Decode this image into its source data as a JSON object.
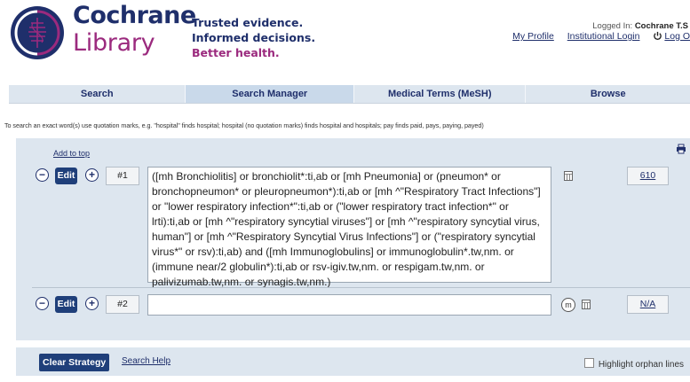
{
  "brand": {
    "line1": "Cochrane",
    "line2": "Library"
  },
  "tagline": {
    "line1": "Trusted evidence.",
    "line2": "Informed decisions.",
    "line3": "Better health."
  },
  "account": {
    "logged_in_label": "Logged In:",
    "logged_in_name": "Cochrane T.S",
    "my_profile": "My Profile",
    "institutional_login": "Institutional Login",
    "log_out": "Log O"
  },
  "tabs": [
    {
      "label": "Search",
      "active": false
    },
    {
      "label": "Search Manager",
      "active": true
    },
    {
      "label": "Medical Terms (MeSH)",
      "active": false
    },
    {
      "label": "Browse",
      "active": false
    }
  ],
  "hint": "To search an exact word(s) use quotation marks, e.g. \"hospital\" finds hospital; hospital (no quotation marks) finds hospital and hospitals; pay finds paid, pays, paying, payed)",
  "search_manager": {
    "add_to_top": "Add to top",
    "rows": [
      {
        "remove": "−",
        "edit_label": "Edit",
        "add": "+",
        "line": "#1",
        "query": "([mh Bronchiolitis] or bronchiolit*:ti,ab or [mh Pneumonia] or (pneumon* or bronchopneumon* or pleuropneumon*):ti,ab or [mh ^\"Respiratory Tract Infections\"] or \"lower respiratory infection*\":ti,ab or (\"lower respiratory tract infection*\" or lrti):ti,ab or [mh ^\"respiratory syncytial viruses\"] or [mh ^\"respiratory syncytial virus, human\"] or [mh ^\"Respiratory Syncytial Virus Infections\"] or (\"respiratory syncytial virus*\" or rsv):ti,ab) and ([mh Immunoglobulins] or immunoglobulin*.tw,nm. or (immune near/2 globulin*):ti,ab or rsv-igiv.tw,nm. or respigam.tw,nm. or palivizumab.tw,nm. or synagis.tw,nm.)",
        "result": "610"
      },
      {
        "remove": "−",
        "edit_label": "Edit",
        "add": "+",
        "line": "#2",
        "query": "",
        "mesh_icon_letter": "m",
        "result": "N/A"
      }
    ]
  },
  "footer": {
    "clear_strategy": "Clear Strategy",
    "search_help": "Search Help",
    "highlight_orphan": "Highlight orphan lines"
  },
  "colors": {
    "brand_navy": "#1f2f6b",
    "brand_purple": "#9b2a7e",
    "panel_bg": "#dde6ef",
    "tab_active": "#c9d9ea",
    "button_bg": "#1f3f7a"
  }
}
